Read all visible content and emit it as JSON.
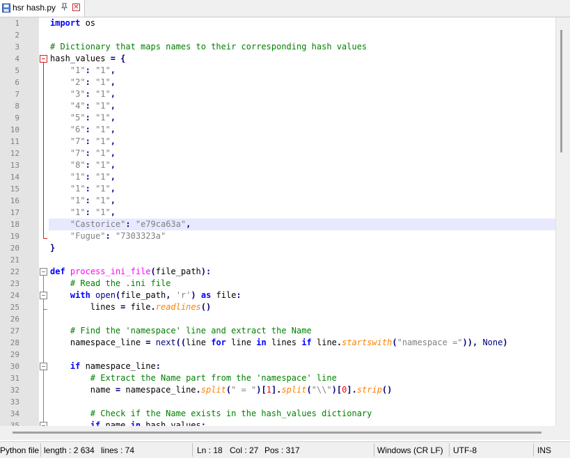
{
  "tab": {
    "title": "hsr hash.py",
    "pin_glyph": "📌",
    "close_glyph": "✕",
    "icon": "file-save-icon"
  },
  "editor": {
    "lines": [
      {
        "n": "1",
        "h": "<span class=\"kw\">import</span> os"
      },
      {
        "n": "2",
        "h": ""
      },
      {
        "n": "3",
        "h": "<span class=\"cm\"># Dictionary that maps names to their corresponding hash values</span>"
      },
      {
        "n": "4",
        "h": "hash_values <span class=\"op\">=</span> <span class=\"op\">{</span>"
      },
      {
        "n": "5",
        "h": "    <span class=\"st\">\"1\"</span><span class=\"op\">:</span> <span class=\"st\">\"1\"</span><span class=\"op\">,</span>"
      },
      {
        "n": "6",
        "h": "    <span class=\"st\">\"2\"</span><span class=\"op\">:</span> <span class=\"st\">\"1\"</span><span class=\"op\">,</span>"
      },
      {
        "n": "7",
        "h": "    <span class=\"st\">\"3\"</span><span class=\"op\">:</span> <span class=\"st\">\"1\"</span><span class=\"op\">,</span>"
      },
      {
        "n": "8",
        "h": "    <span class=\"st\">\"4\"</span><span class=\"op\">:</span> <span class=\"st\">\"1\"</span><span class=\"op\">,</span>"
      },
      {
        "n": "9",
        "h": "    <span class=\"st\">\"5\"</span><span class=\"op\">:</span> <span class=\"st\">\"1\"</span><span class=\"op\">,</span>"
      },
      {
        "n": "10",
        "h": "    <span class=\"st\">\"6\"</span><span class=\"op\">:</span> <span class=\"st\">\"1\"</span><span class=\"op\">,</span>"
      },
      {
        "n": "11",
        "h": "    <span class=\"st\">\"7\"</span><span class=\"op\">:</span> <span class=\"st\">\"1\"</span><span class=\"op\">,</span>"
      },
      {
        "n": "12",
        "h": "    <span class=\"st\">\"7\"</span><span class=\"op\">:</span> <span class=\"st\">\"1\"</span><span class=\"op\">,</span>"
      },
      {
        "n": "13",
        "h": "    <span class=\"st\">\"8\"</span><span class=\"op\">:</span> <span class=\"st\">\"1\"</span><span class=\"op\">,</span>"
      },
      {
        "n": "14",
        "h": "    <span class=\"st\">\"1\"</span><span class=\"op\">:</span> <span class=\"st\">\"1\"</span><span class=\"op\">,</span>"
      },
      {
        "n": "15",
        "h": "    <span class=\"st\">\"1\"</span><span class=\"op\">:</span> <span class=\"st\">\"1\"</span><span class=\"op\">,</span>"
      },
      {
        "n": "16",
        "h": "    <span class=\"st\">\"1\"</span><span class=\"op\">:</span> <span class=\"st\">\"1\"</span><span class=\"op\">,</span>"
      },
      {
        "n": "17",
        "h": "    <span class=\"st\">\"1\"</span><span class=\"op\">:</span> <span class=\"st\">\"1\"</span><span class=\"op\">,</span>"
      },
      {
        "n": "18",
        "h": "    <span class=\"st\">\"Castorice\"</span><span class=\"op\">:</span> <span class=\"st\">\"e79ca63a\"</span><span class=\"op\">,</span>"
      },
      {
        "n": "19",
        "h": "    <span class=\"st\">\"Fugue\"</span><span class=\"op\">:</span> <span class=\"st\">\"7303323a\"</span>"
      },
      {
        "n": "20",
        "h": "<span class=\"op\">}</span>"
      },
      {
        "n": "21",
        "h": ""
      },
      {
        "n": "22",
        "h": "<span class=\"kw\">def</span> <span class=\"fn\">process_ini_file</span><span class=\"op\">(</span>file_path<span class=\"op\">):</span>"
      },
      {
        "n": "23",
        "h": "    <span class=\"cm\"># Read the .ini file</span>"
      },
      {
        "n": "24",
        "h": "    <span class=\"kw\">with</span> <span class=\"bi\">open</span><span class=\"op\">(</span>file_path<span class=\"op\">,</span> <span class=\"st\">'r'</span><span class=\"op\">)</span> <span class=\"kw\">as</span> file<span class=\"op\">:</span>"
      },
      {
        "n": "25",
        "h": "        lines <span class=\"op\">=</span> file<span class=\"op\">.</span><span class=\"it\">readlines</span><span class=\"op\">()</span>"
      },
      {
        "n": "26",
        "h": ""
      },
      {
        "n": "27",
        "h": "    <span class=\"cm\"># Find the 'namespace' line and extract the Name</span>"
      },
      {
        "n": "28",
        "h": "    namespace_line <span class=\"op\">=</span> <span class=\"bi\">next</span><span class=\"op\">((</span>line <span class=\"kw\">for</span> line <span class=\"kw\">in</span> lines <span class=\"kw\">if</span> line<span class=\"op\">.</span><span class=\"it\">startswith</span><span class=\"op\">(</span><span class=\"st\">\"namespace =\"</span><span class=\"op\">)),</span> <span class=\"bi\">None</span><span class=\"op\">)</span>"
      },
      {
        "n": "29",
        "h": ""
      },
      {
        "n": "30",
        "h": "    <span class=\"kw\">if</span> namespace_line<span class=\"op\">:</span>"
      },
      {
        "n": "31",
        "h": "        <span class=\"cm\"># Extract the Name part from the 'namespace' line</span>"
      },
      {
        "n": "32",
        "h": "        name <span class=\"op\">=</span> namespace_line<span class=\"op\">.</span><span class=\"it\">split</span><span class=\"op\">(</span><span class=\"st\">\" = \"</span><span class=\"op\">)[</span><span class=\"nb\">1</span><span class=\"op\">].</span><span class=\"it\">split</span><span class=\"op\">(</span><span class=\"st\">\"\\\\\"</span><span class=\"op\">)[</span><span class=\"nb\">0</span><span class=\"op\">].</span><span class=\"it\">strip</span><span class=\"op\">()</span>"
      },
      {
        "n": "33",
        "h": ""
      },
      {
        "n": "34",
        "h": "        <span class=\"cm\"># Check if the Name exists in the hash_values dictionary</span>"
      },
      {
        "n": "35",
        "h": "        <span class=\"kw\">if</span> name <span class=\"kw\">in</span> hash_values<span class=\"op\">:</span>"
      }
    ]
  },
  "status": {
    "file_type": "Python file",
    "length": "length : 2 634",
    "lines": "lines : 74",
    "ln": "Ln : 18",
    "col": "Col : 27",
    "pos": "Pos : 317",
    "eol": "Windows (CR LF)",
    "encoding": "UTF-8",
    "mode": "INS"
  },
  "colors": {
    "keyword": "#0000ff",
    "comment": "#008000",
    "string": "#808080",
    "function": "#ff00ff",
    "current_line": "#e8e8ff",
    "fold_active": "#d02020"
  }
}
